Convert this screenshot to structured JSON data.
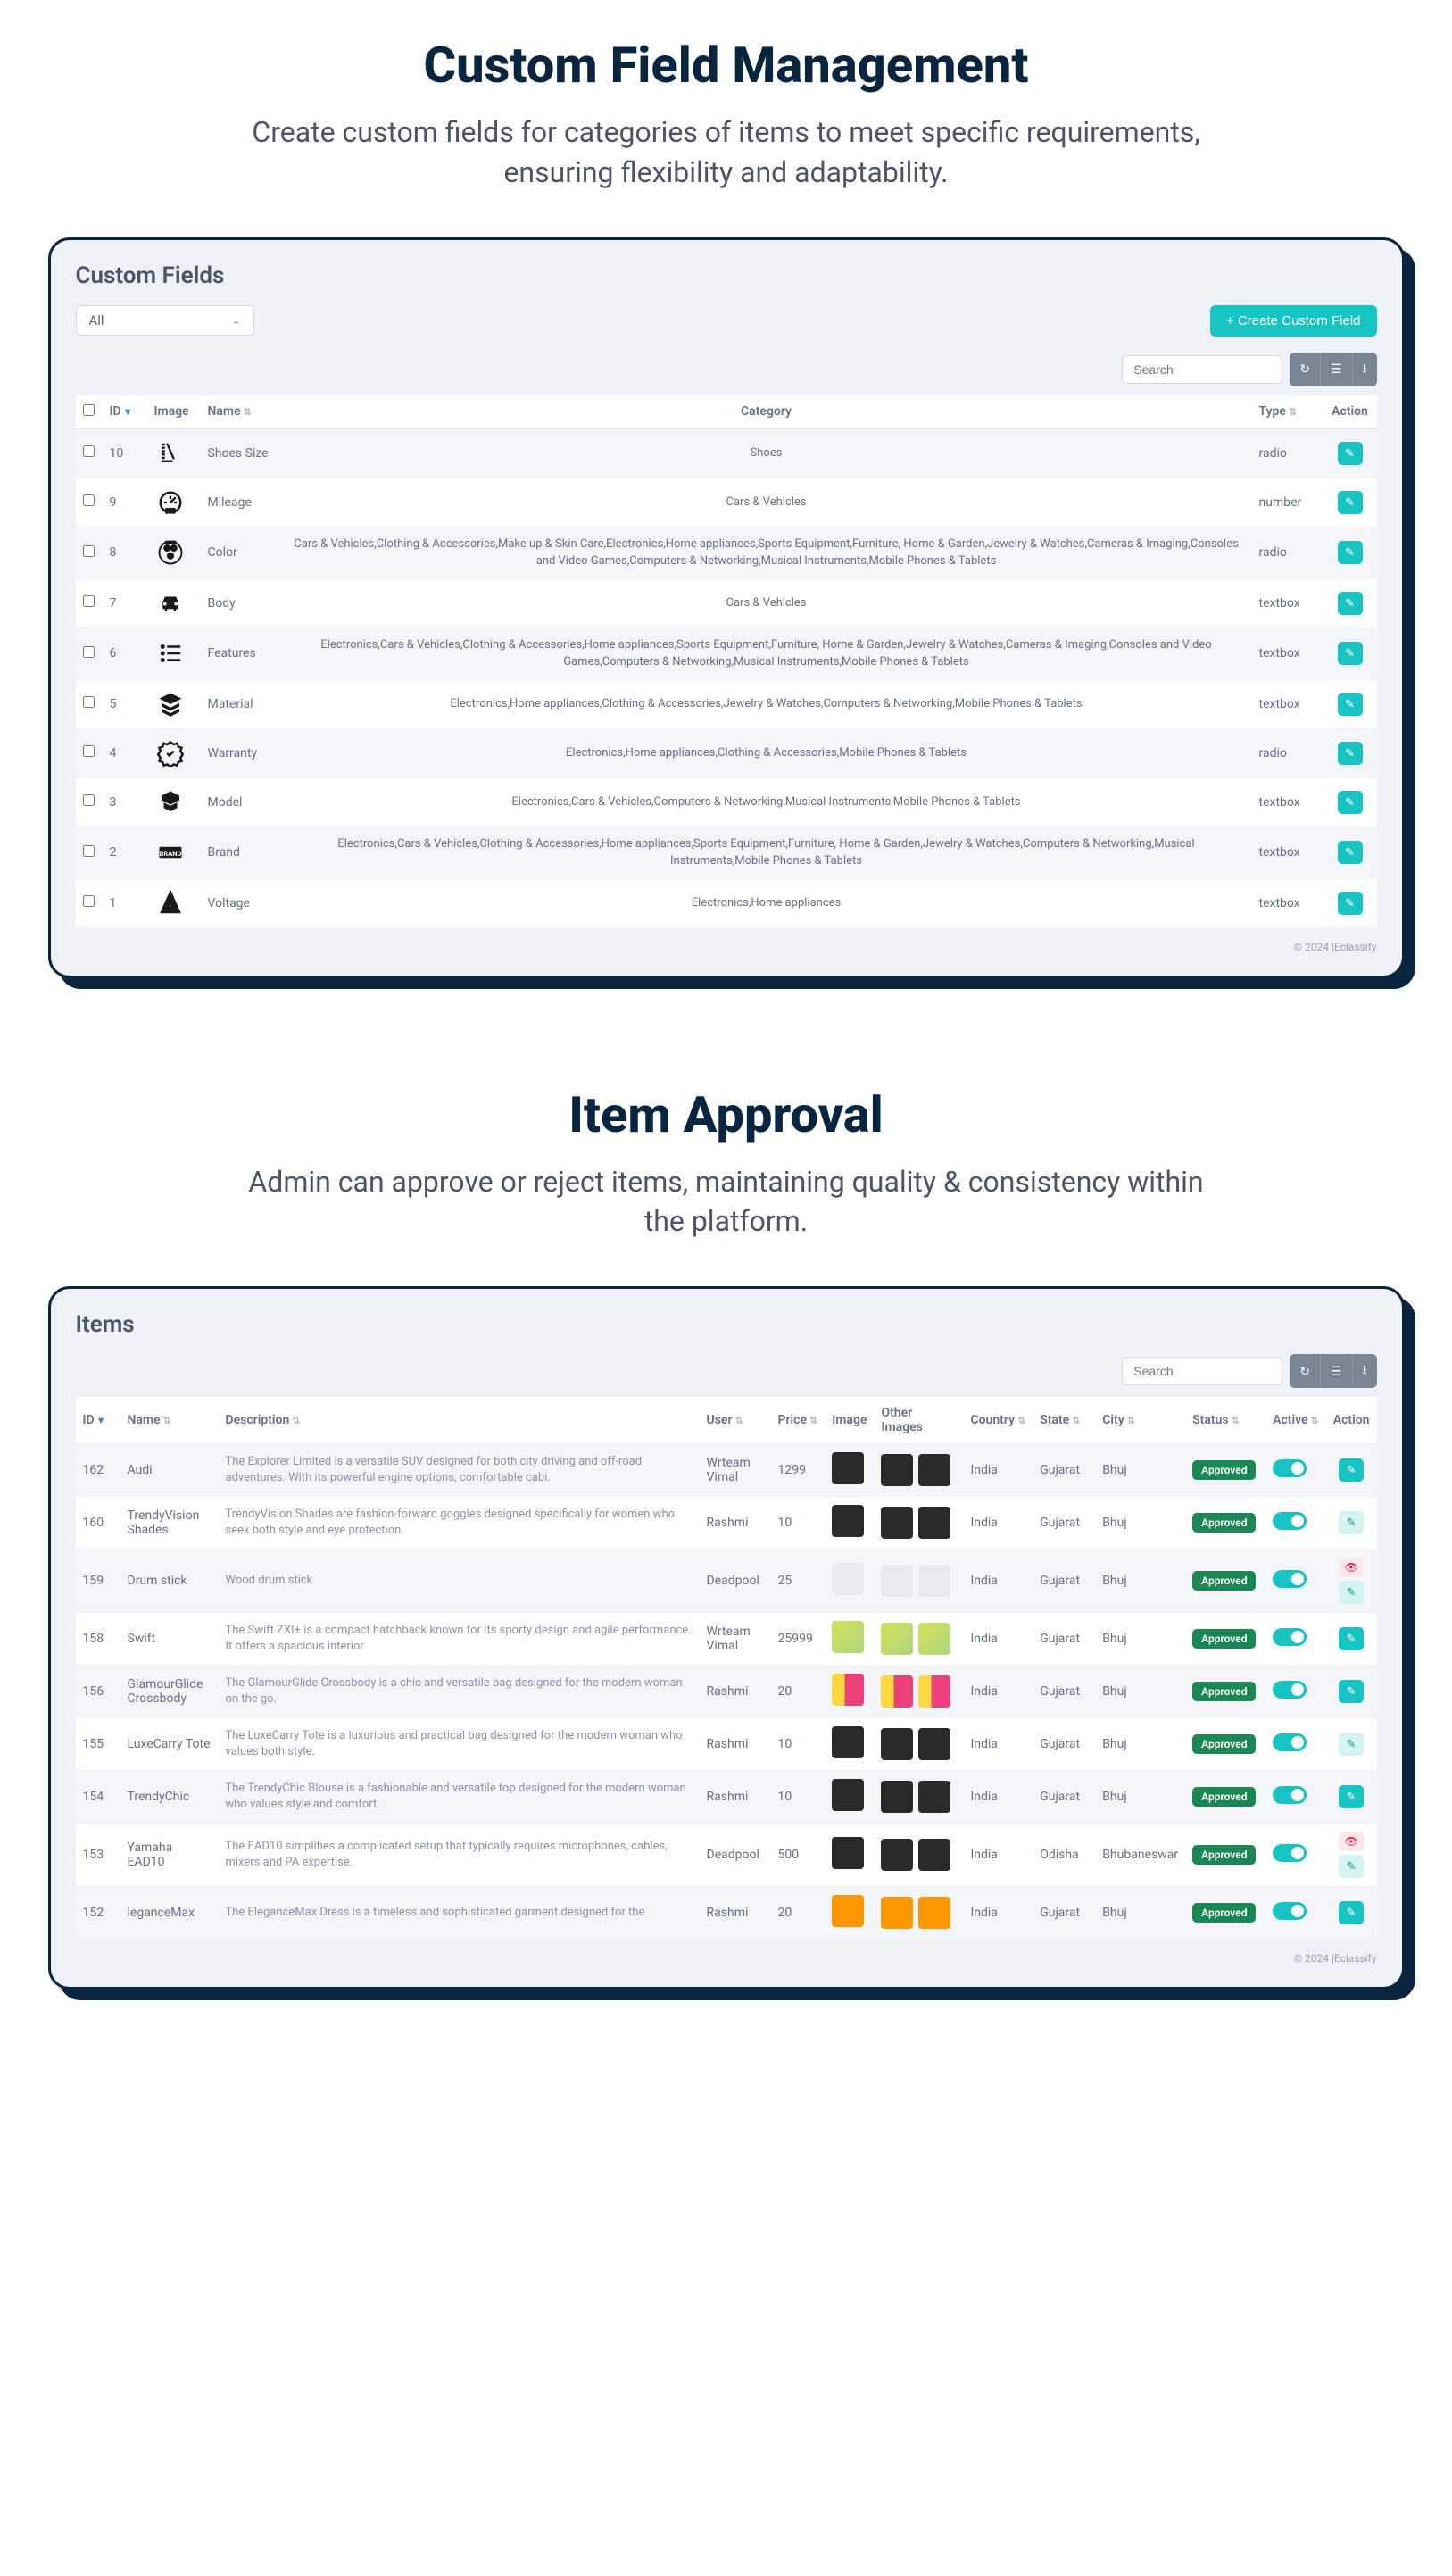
{
  "section1": {
    "title": "Custom Field Management",
    "subtitle": "Create custom fields for categories of items to meet specific requirements, ensuring flexibility and adaptability.",
    "panelTitle": "Custom Fields",
    "filter": "All",
    "createBtn": "+ Create Custom Field",
    "searchPlaceholder": "Search",
    "headers": {
      "id": "ID",
      "image": "Image",
      "name": "Name",
      "category": "Category",
      "type": "Type",
      "action": "Action"
    },
    "rows": [
      {
        "id": "10",
        "name": "Shoes Size",
        "category": "Shoes",
        "type": "radio",
        "icon": "shoe"
      },
      {
        "id": "9",
        "name": "Mileage",
        "category": "Cars & Vehicles",
        "type": "number",
        "icon": "gauge"
      },
      {
        "id": "8",
        "name": "Color",
        "category": "Cars & Vehicles,Clothing & Accessories,Make up & Skin Care,Electronics,Home appliances,Sports Equipment,Furniture, Home & Garden,Jewelry & Watches,Cameras & Imaging,Consoles and Video Games,Computers & Networking,Musical Instruments,Mobile Phones & Tablets",
        "type": "radio",
        "icon": "color"
      },
      {
        "id": "7",
        "name": "Body",
        "category": "Cars & Vehicles",
        "type": "textbox",
        "icon": "car"
      },
      {
        "id": "6",
        "name": "Features",
        "category": "Electronics,Cars & Vehicles,Clothing & Accessories,Home appliances,Sports Equipment,Furniture, Home & Garden,Jewelry & Watches,Cameras & Imaging,Consoles and Video Games,Computers & Networking,Musical Instruments,Mobile Phones & Tablets",
        "type": "textbox",
        "icon": "list"
      },
      {
        "id": "5",
        "name": "Material",
        "category": "Electronics,Home appliances,Clothing & Accessories,Jewelry & Watches,Computers & Networking,Mobile Phones & Tablets",
        "type": "textbox",
        "icon": "layers"
      },
      {
        "id": "4",
        "name": "Warranty",
        "category": "Electronics,Home appliances,Clothing & Accessories,Mobile Phones & Tablets",
        "type": "radio",
        "icon": "badge"
      },
      {
        "id": "3",
        "name": "Model",
        "category": "Electronics,Cars & Vehicles,Computers & Networking,Musical Instruments,Mobile Phones & Tablets",
        "type": "textbox",
        "icon": "model"
      },
      {
        "id": "2",
        "name": "Brand",
        "category": "Electronics,Cars & Vehicles,Clothing & Accessories,Home appliances,Sports Equipment,Furniture, Home & Garden,Jewelry & Watches,Computers & Networking,Musical Instruments,Mobile Phones & Tablets",
        "type": "textbox",
        "icon": "brand"
      },
      {
        "id": "1",
        "name": "Voltage",
        "category": "Electronics,Home appliances",
        "type": "textbox",
        "icon": "bolt"
      }
    ],
    "copyright": "© 2024 |Eclassify"
  },
  "section2": {
    "title": "Item Approval",
    "subtitle": "Admin can approve or reject items, maintaining quality & consistency within the platform.",
    "panelTitle": "Items",
    "searchPlaceholder": "Search",
    "headers": {
      "id": "ID",
      "name": "Name",
      "description": "Description",
      "user": "User",
      "price": "Price",
      "image": "Image",
      "otherImages": "Other Images",
      "country": "Country",
      "state": "State",
      "city": "City",
      "status": "Status",
      "active": "Active",
      "action": "Action"
    },
    "approved": "Approved",
    "rows": [
      {
        "id": "162",
        "name": "Audi",
        "desc": "The Explorer Limited is a versatile SUV designed for both city driving and off-road adventures. With its powerful engine options, comfortable cabi.",
        "user": "Wrteam Vimal",
        "price": "1299",
        "country": "India",
        "state": "Gujarat",
        "city": "Bhuj",
        "imgcls": "dark",
        "act": "teal"
      },
      {
        "id": "160",
        "name": "TrendyVision Shades",
        "desc": "TrendyVision Shades are fashion-forward goggles designed specifically for women who seek both style and eye protection.",
        "user": "Rashmi",
        "price": "10",
        "country": "India",
        "state": "Gujarat",
        "city": "Bhuj",
        "imgcls": "dark",
        "act": "lt"
      },
      {
        "id": "159",
        "name": "Drum stick",
        "desc": "Wood drum stick",
        "user": "Deadpool",
        "price": "25",
        "country": "India",
        "state": "Gujarat",
        "city": "Bhuj",
        "imgcls": "light",
        "act": "eye"
      },
      {
        "id": "158",
        "name": "Swift",
        "desc": "The Swift ZXI+ is a compact hatchback known for its sporty design and agile performance. It offers a spacious interior",
        "user": "Wrteam Vimal",
        "price": "25999",
        "country": "India",
        "state": "Gujarat",
        "city": "Bhuj",
        "imgcls": "car",
        "act": "teal"
      },
      {
        "id": "156",
        "name": "GlamourGlide Crossbody",
        "desc": "The GlamourGlide Crossbody is a chic and versatile bag designed for the modern woman on the go.",
        "user": "Rashmi",
        "price": "20",
        "country": "India",
        "state": "Gujarat",
        "city": "Bhuj",
        "imgcls": "pink",
        "act": "teal"
      },
      {
        "id": "155",
        "name": "LuxeCarry Tote",
        "desc": "The LuxeCarry Tote is a luxurious and practical bag designed for the modern woman who values both style.",
        "user": "Rashmi",
        "price": "10",
        "country": "India",
        "state": "Gujarat",
        "city": "Bhuj",
        "imgcls": "dark",
        "act": "lt"
      },
      {
        "id": "154",
        "name": "TrendyChic",
        "desc": "The TrendyChic Blouse is a fashionable and versatile top designed for the modern woman who values style and comfort.",
        "user": "Rashmi",
        "price": "10",
        "country": "India",
        "state": "Gujarat",
        "city": "Bhuj",
        "imgcls": "dark",
        "act": "teal"
      },
      {
        "id": "153",
        "name": "Yamaha EAD10",
        "desc": "The EAD10 simplifies a complicated setup that typically requires microphones, cables, mixers and PA expertise.",
        "user": "Deadpool",
        "price": "500",
        "country": "India",
        "state": "Odisha",
        "city": "Bhubaneswar",
        "imgcls": "dark",
        "act": "eye"
      },
      {
        "id": "152",
        "name": "leganceMax",
        "desc": "The EleganceMax Dress is a timeless and sophisticated garment designed for the",
        "user": "Rashmi",
        "price": "20",
        "country": "India",
        "state": "Gujarat",
        "city": "Bhuj",
        "imgcls": "orange",
        "act": "teal"
      }
    ],
    "copyright": "© 2024 |Eclassify"
  }
}
